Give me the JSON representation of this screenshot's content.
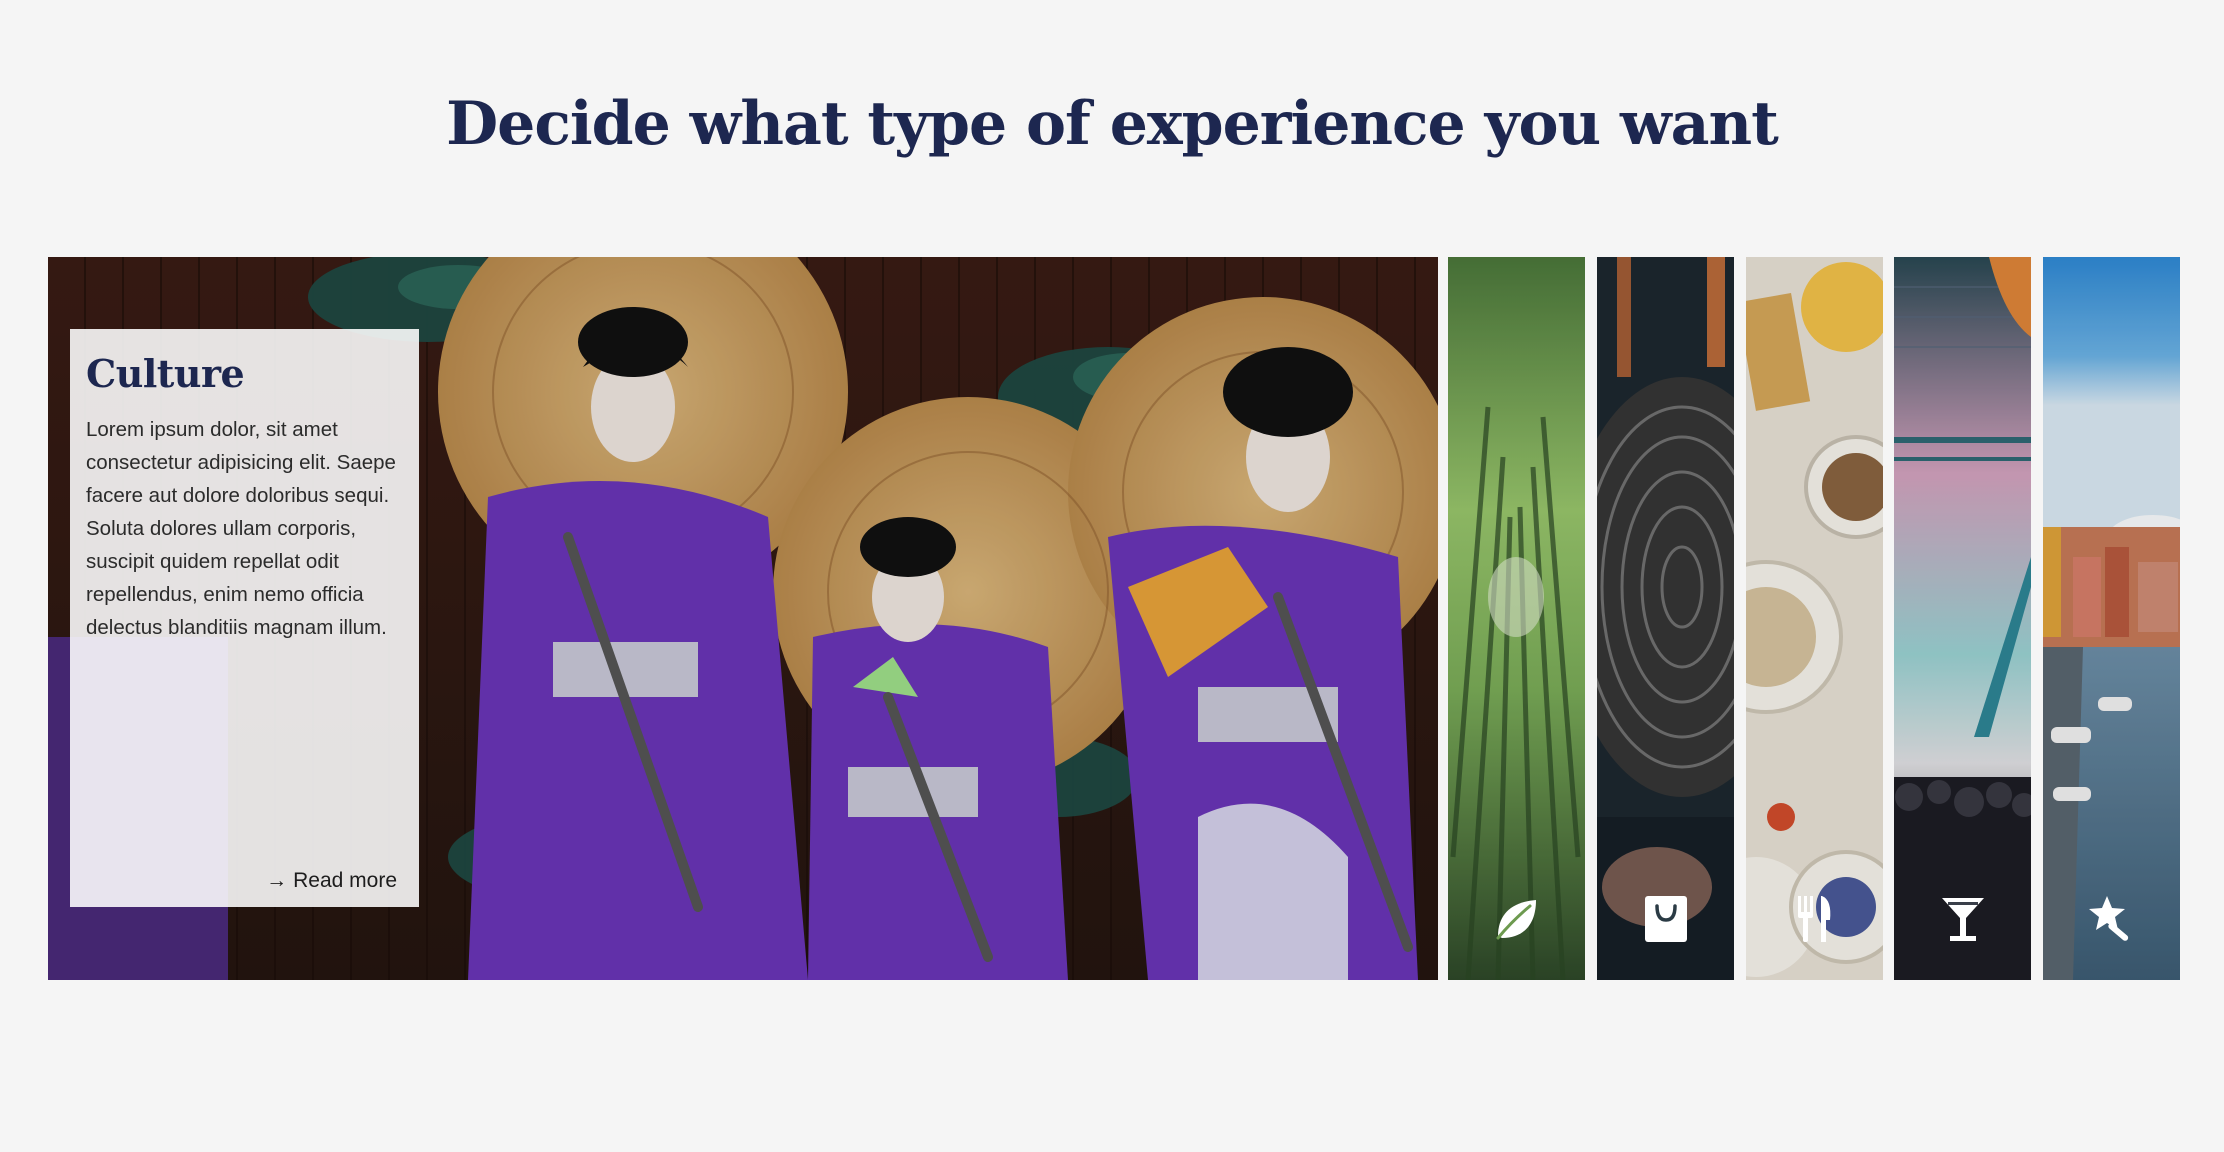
{
  "heading": "Decide what type of experience you want",
  "featured": {
    "title": "Culture",
    "body": "Lorem ipsum dolor, sit amet consectetur adipisicing elit. Saepe facere aut dolore doloribus sequi. Soluta dolores ullam corporis, suscipit quidem repellat odit repellendus, enim nemo officia delectus blanditiis magnam illum.",
    "read_more_label": "Read more",
    "read_more_icon": "arrow-right-icon"
  },
  "categories": [
    {
      "icon": "leaf-icon"
    },
    {
      "icon": "shopping-bag-icon"
    },
    {
      "icon": "fork-knife-icon"
    },
    {
      "icon": "cocktail-icon"
    },
    {
      "icon": "magic-wand-icon"
    }
  ],
  "colors": {
    "background": "#f5f5f5",
    "heading": "#1d2750",
    "card_background": "#ffffff",
    "icon": "#ffffff"
  }
}
